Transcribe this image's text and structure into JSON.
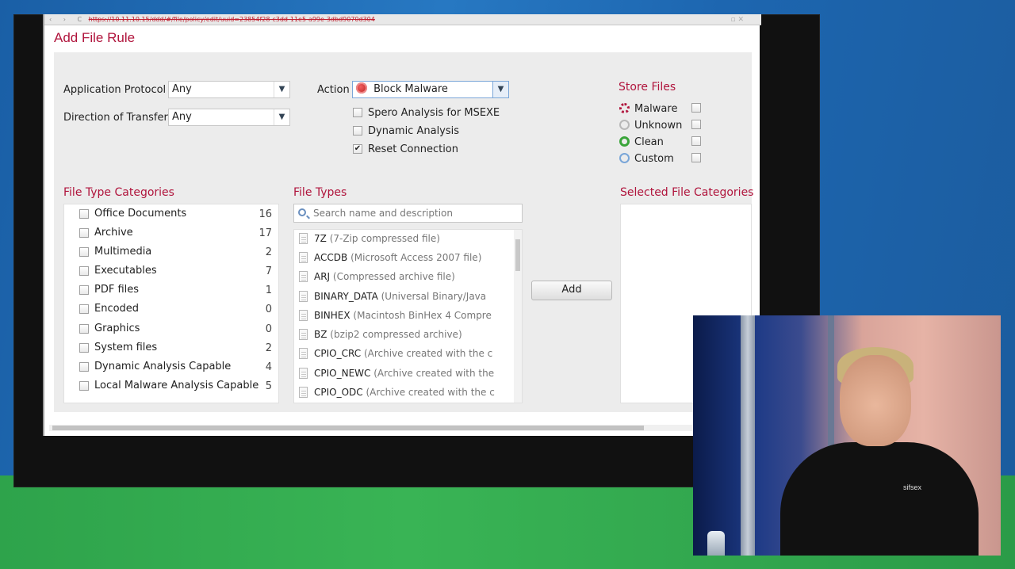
{
  "browser": {
    "url": "https://10.11.10.15/ddd/#/file/policy/edit/uuid=23854f28-c3dd-11e5-a99e-3dbd9070d304"
  },
  "dialog": {
    "title": "Add File Rule"
  },
  "form": {
    "application_protocol_label": "Application Protocol",
    "application_protocol_value": "Any",
    "direction_label": "Direction of Transfer",
    "direction_value": "Any",
    "action_label": "Action",
    "action_value": "Block Malware",
    "options": [
      {
        "label": "Spero Analysis for MSEXE",
        "checked": false
      },
      {
        "label": "Dynamic Analysis",
        "checked": false
      },
      {
        "label": "Reset Connection",
        "checked": true
      }
    ]
  },
  "store_files": {
    "title": "Store Files",
    "items": [
      {
        "label": "Malware",
        "icon": "malware-ring-icon",
        "checked": false
      },
      {
        "label": "Unknown",
        "icon": "unknown-ring-icon",
        "checked": false
      },
      {
        "label": "Clean",
        "icon": "clean-ring-icon",
        "checked": false
      },
      {
        "label": "Custom",
        "icon": "custom-ring-icon",
        "checked": false
      }
    ]
  },
  "categories": {
    "title": "File Type Categories",
    "items": [
      {
        "name": "Office Documents",
        "count": "16"
      },
      {
        "name": "Archive",
        "count": "17"
      },
      {
        "name": "Multimedia",
        "count": "2"
      },
      {
        "name": "Executables",
        "count": "7"
      },
      {
        "name": "PDF files",
        "count": "1"
      },
      {
        "name": "Encoded",
        "count": "0"
      },
      {
        "name": "Graphics",
        "count": "0"
      },
      {
        "name": "System files",
        "count": "2"
      },
      {
        "name": "Dynamic Analysis Capable",
        "count": "4"
      },
      {
        "name": "Local Malware Analysis Capable",
        "count": "5"
      }
    ]
  },
  "file_types": {
    "title": "File Types",
    "search_placeholder": "Search name and description",
    "items": [
      {
        "code": "7Z",
        "desc": "(7-Zip compressed file)"
      },
      {
        "code": "ACCDB",
        "desc": "(Microsoft Access 2007 file)"
      },
      {
        "code": "ARJ",
        "desc": "(Compressed archive file)"
      },
      {
        "code": "BINARY_DATA",
        "desc": "(Universal Binary/Java"
      },
      {
        "code": "BINHEX",
        "desc": "(Macintosh BinHex 4 Compre"
      },
      {
        "code": "BZ",
        "desc": "(bzip2 compressed archive)"
      },
      {
        "code": "CPIO_CRC",
        "desc": "(Archive created with the c"
      },
      {
        "code": "CPIO_NEWC",
        "desc": "(Archive created with the"
      },
      {
        "code": "CPIO_ODC",
        "desc": "(Archive created with the c"
      }
    ]
  },
  "add_button": {
    "label": "Add"
  },
  "selected": {
    "title": "Selected File Categories"
  },
  "webcam": {
    "shirt_logo": "sifsex"
  }
}
